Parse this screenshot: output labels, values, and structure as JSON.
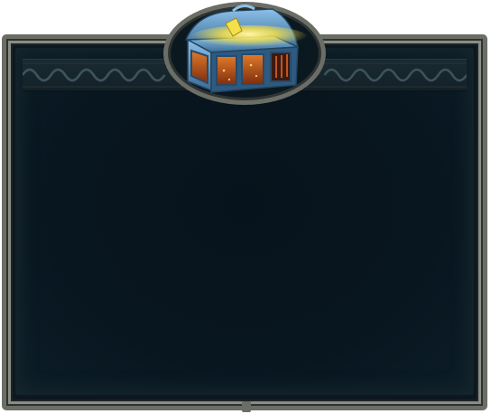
{
  "panel": {
    "background_color": "#0c1720",
    "frame_color": "#6b6e66",
    "content_text": ""
  },
  "header": {
    "emblem_icon": "treasure-chest-icon",
    "emblem_colors": {
      "chest_metal": "#4a7fb0",
      "chest_glow": "#f4e04a",
      "chest_wood": "#c1541e"
    },
    "frieze_pattern": "wave-scroll"
  }
}
